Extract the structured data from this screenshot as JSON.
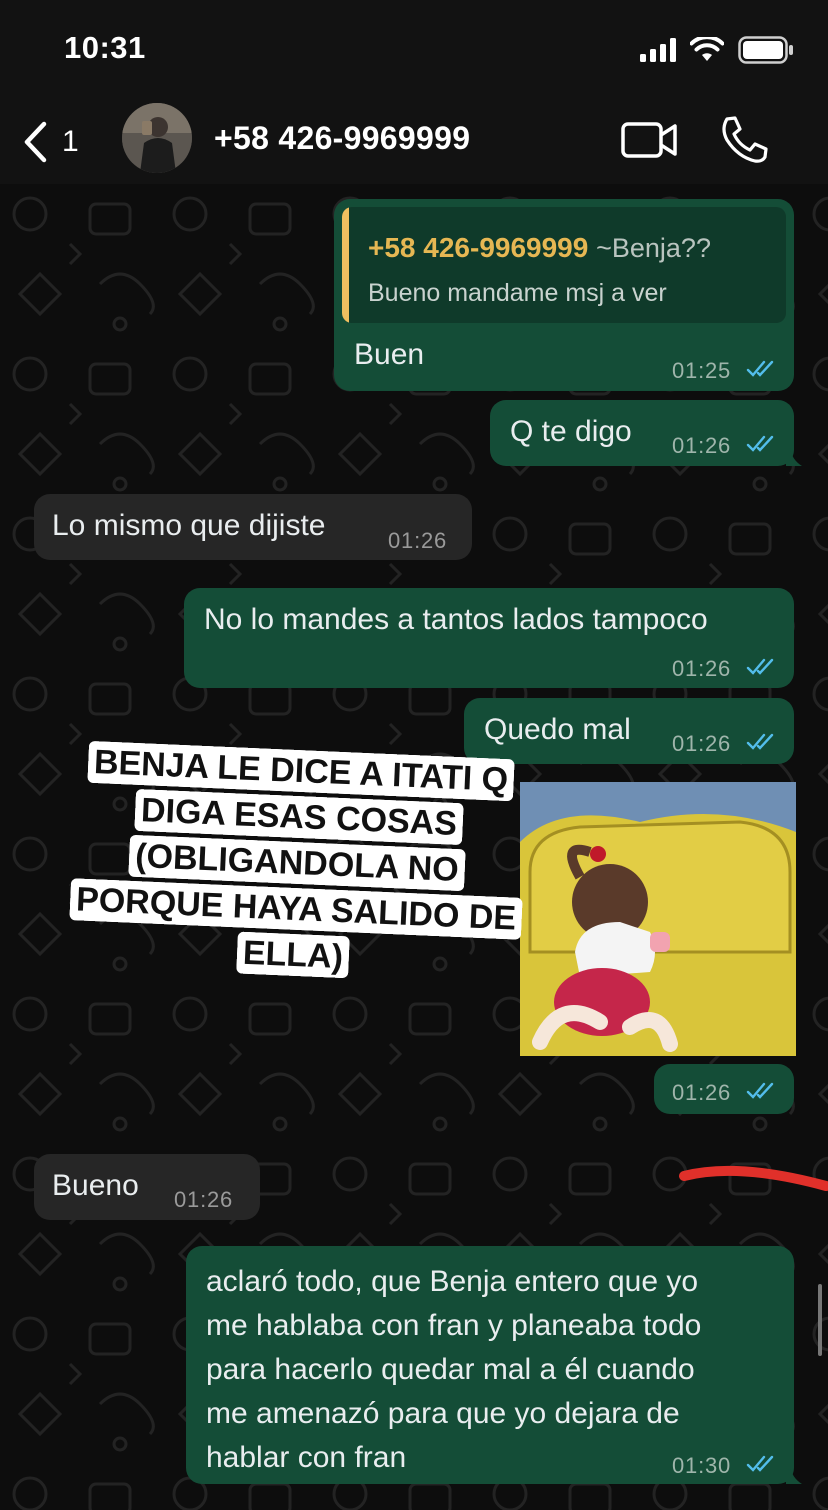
{
  "status_bar": {
    "time": "10:31"
  },
  "header": {
    "back_count": "1",
    "contact_name": "+58 426-9969999"
  },
  "messages": [
    {
      "direction": "out",
      "quote": {
        "author": "+58 426-9969999",
        "alias": "~Benja??",
        "text": "Bueno mandame msj a ver"
      },
      "text": "Buen",
      "time": "01:25"
    },
    {
      "direction": "out",
      "text": "Q te digo",
      "time": "01:26"
    },
    {
      "direction": "in",
      "text": "Lo mismo que dijiste",
      "time": "01:26"
    },
    {
      "direction": "out",
      "text": "No lo mandes a tantos lados tampoco",
      "time": "01:26"
    },
    {
      "direction": "out",
      "text": "Quedo mal",
      "time": "01:26"
    },
    {
      "direction": "out",
      "type": "image",
      "time": "01:26"
    },
    {
      "direction": "in",
      "text": "Bueno",
      "time": "01:26"
    },
    {
      "direction": "out",
      "lines": [
        "aclaró todo, que Benja entero que yo",
        "me hablaba con fran y planeaba todo",
        "para hacerlo quedar mal a él cuando",
        "me amenazó para que yo dejara de",
        "hablar con fran"
      ],
      "time": "01:30"
    }
  ],
  "overlay_caption": "BENJA LE DICE A ITATI Q DIGA ESAS COSAS (OBLIGANDOLA NO PORQUE HAYA SALIDO DE ELLA)",
  "colors": {
    "outgoing_bubble": "#144d37",
    "incoming_bubble": "#262626",
    "read_ticks": "#53bdeb",
    "quote_accent": "#f0c060",
    "annotation_stroke": "#e0302a"
  }
}
